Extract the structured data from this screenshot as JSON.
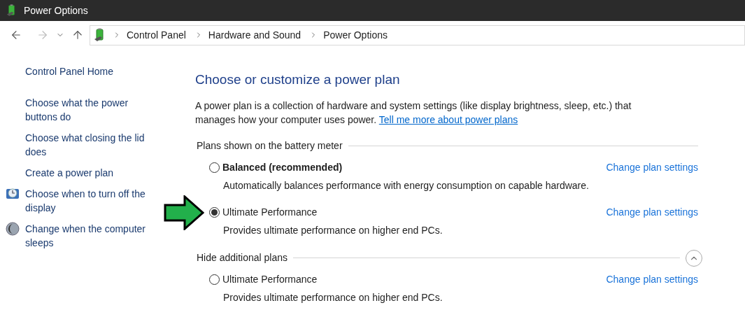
{
  "window": {
    "title": "Power Options"
  },
  "breadcrumb": [
    "Control Panel",
    "Hardware and Sound",
    "Power Options"
  ],
  "sidebar": {
    "items": [
      {
        "label": "Control Panel Home",
        "kind": "home"
      },
      {
        "label": "Choose what the power buttons do",
        "kind": "link"
      },
      {
        "label": "Choose what closing the lid does",
        "kind": "link"
      },
      {
        "label": "Create a power plan",
        "kind": "link"
      },
      {
        "label": "Choose when to turn off the display",
        "kind": "display"
      },
      {
        "label": "Change when the computer sleeps",
        "kind": "sleep"
      }
    ]
  },
  "main": {
    "title": "Choose or customize a power plan",
    "intro": "A power plan is a collection of hardware and system settings (like display brightness, sleep, etc.) that manages how your computer uses power.",
    "intro_link": "Tell me more about power plans",
    "sections": [
      {
        "heading": "Plans shown on the battery meter",
        "plans": [
          {
            "name": "Balanced (recommended)",
            "emphasized": true,
            "selected": false,
            "description": "Automatically balances performance with energy consumption on capable hardware.",
            "link": "Change plan settings"
          },
          {
            "name": "Ultimate Performance",
            "emphasized": false,
            "selected": true,
            "description": "Provides ultimate performance on higher end PCs.",
            "link": "Change plan settings"
          }
        ]
      },
      {
        "heading": "Hide additional plans",
        "expanded": true,
        "plans": [
          {
            "name": "Ultimate Performance",
            "emphasized": false,
            "selected": false,
            "description": "Provides ultimate performance on higher end PCs.",
            "link": "Change plan settings"
          }
        ]
      }
    ]
  }
}
